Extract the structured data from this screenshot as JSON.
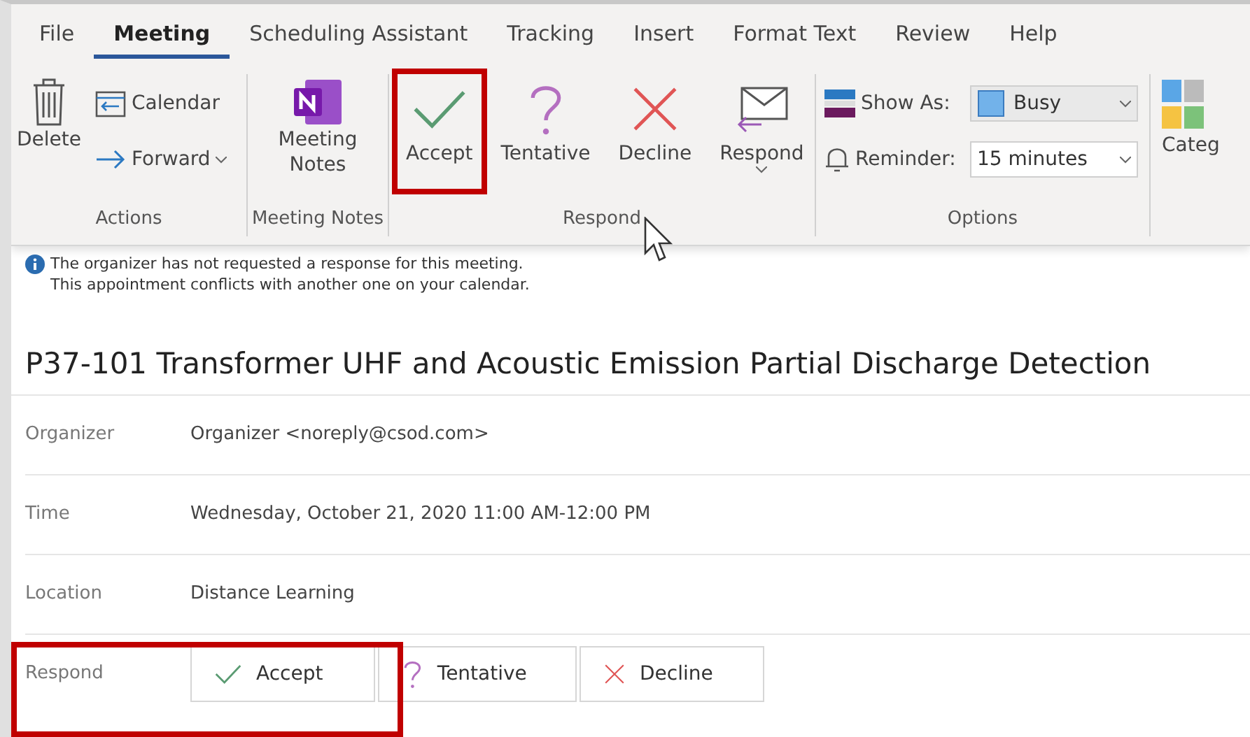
{
  "tabs": [
    {
      "label": "File",
      "selected": false
    },
    {
      "label": "Meeting",
      "selected": true
    },
    {
      "label": "Scheduling Assistant",
      "selected": false
    },
    {
      "label": "Tracking",
      "selected": false
    },
    {
      "label": "Insert",
      "selected": false
    },
    {
      "label": "Format Text",
      "selected": false
    },
    {
      "label": "Review",
      "selected": false
    },
    {
      "label": "Help",
      "selected": false
    }
  ],
  "ribbon": {
    "actions": {
      "label": "Actions",
      "delete": "Delete",
      "calendar": "Calendar",
      "forward": "Forward"
    },
    "meeting_notes": {
      "label": "Meeting Notes",
      "button": "Meeting Notes"
    },
    "respond": {
      "label": "Respond",
      "buttons": [
        {
          "kind": "accept",
          "label": "Accept",
          "highlighted": true
        },
        {
          "kind": "tentative",
          "label": "Tentative",
          "highlighted": false
        },
        {
          "kind": "decline",
          "label": "Decline",
          "highlighted": false
        },
        {
          "kind": "respond",
          "label": "Respond",
          "highlighted": false
        }
      ]
    },
    "options": {
      "label": "Options",
      "show_as_label": "Show As:",
      "show_as": "Busy",
      "reminder_label": "Reminder:",
      "reminder": "15 minutes"
    },
    "categorize": {
      "label": "Categ"
    }
  },
  "info": [
    "The organizer has not requested a response for this meeting.",
    "This appointment conflicts with another one on your calendar."
  ],
  "subject": "P37-101 Transformer UHF and Acoustic Emission Partial Discharge Detection",
  "fields": [
    {
      "label": "Organizer",
      "value": "Organizer <noreply@csod.com>"
    },
    {
      "label": "Time",
      "value": "Wednesday, October 21, 2020 11:00 AM-12:00 PM"
    },
    {
      "label": "Location",
      "value": "Distance Learning"
    }
  ],
  "respond_row": {
    "label": "Respond",
    "highlighted": true,
    "buttons": [
      {
        "kind": "accept",
        "label": "Accept"
      },
      {
        "kind": "tentative",
        "label": "Tentative"
      },
      {
        "kind": "decline",
        "label": "Decline"
      }
    ]
  }
}
